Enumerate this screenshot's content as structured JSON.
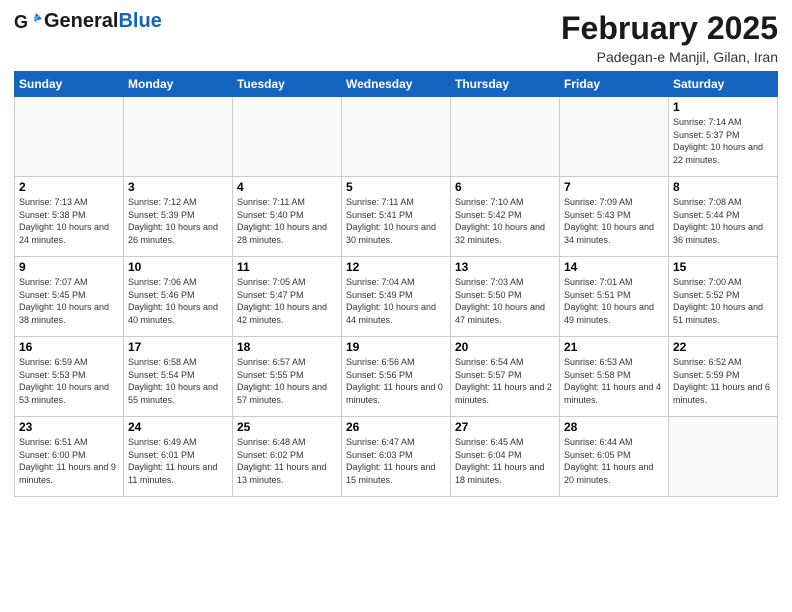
{
  "logo": {
    "general": "General",
    "blue": "Blue"
  },
  "title": "February 2025",
  "subtitle": "Padegan-e Manjil, Gilan, Iran",
  "headers": [
    "Sunday",
    "Monday",
    "Tuesday",
    "Wednesday",
    "Thursday",
    "Friday",
    "Saturday"
  ],
  "weeks": [
    [
      {
        "day": "",
        "info": ""
      },
      {
        "day": "",
        "info": ""
      },
      {
        "day": "",
        "info": ""
      },
      {
        "day": "",
        "info": ""
      },
      {
        "day": "",
        "info": ""
      },
      {
        "day": "",
        "info": ""
      },
      {
        "day": "1",
        "info": "Sunrise: 7:14 AM\nSunset: 5:37 PM\nDaylight: 10 hours\nand 22 minutes."
      }
    ],
    [
      {
        "day": "2",
        "info": "Sunrise: 7:13 AM\nSunset: 5:38 PM\nDaylight: 10 hours\nand 24 minutes."
      },
      {
        "day": "3",
        "info": "Sunrise: 7:12 AM\nSunset: 5:39 PM\nDaylight: 10 hours\nand 26 minutes."
      },
      {
        "day": "4",
        "info": "Sunrise: 7:11 AM\nSunset: 5:40 PM\nDaylight: 10 hours\nand 28 minutes."
      },
      {
        "day": "5",
        "info": "Sunrise: 7:11 AM\nSunset: 5:41 PM\nDaylight: 10 hours\nand 30 minutes."
      },
      {
        "day": "6",
        "info": "Sunrise: 7:10 AM\nSunset: 5:42 PM\nDaylight: 10 hours\nand 32 minutes."
      },
      {
        "day": "7",
        "info": "Sunrise: 7:09 AM\nSunset: 5:43 PM\nDaylight: 10 hours\nand 34 minutes."
      },
      {
        "day": "8",
        "info": "Sunrise: 7:08 AM\nSunset: 5:44 PM\nDaylight: 10 hours\nand 36 minutes."
      }
    ],
    [
      {
        "day": "9",
        "info": "Sunrise: 7:07 AM\nSunset: 5:45 PM\nDaylight: 10 hours\nand 38 minutes."
      },
      {
        "day": "10",
        "info": "Sunrise: 7:06 AM\nSunset: 5:46 PM\nDaylight: 10 hours\nand 40 minutes."
      },
      {
        "day": "11",
        "info": "Sunrise: 7:05 AM\nSunset: 5:47 PM\nDaylight: 10 hours\nand 42 minutes."
      },
      {
        "day": "12",
        "info": "Sunrise: 7:04 AM\nSunset: 5:49 PM\nDaylight: 10 hours\nand 44 minutes."
      },
      {
        "day": "13",
        "info": "Sunrise: 7:03 AM\nSunset: 5:50 PM\nDaylight: 10 hours\nand 47 minutes."
      },
      {
        "day": "14",
        "info": "Sunrise: 7:01 AM\nSunset: 5:51 PM\nDaylight: 10 hours\nand 49 minutes."
      },
      {
        "day": "15",
        "info": "Sunrise: 7:00 AM\nSunset: 5:52 PM\nDaylight: 10 hours\nand 51 minutes."
      }
    ],
    [
      {
        "day": "16",
        "info": "Sunrise: 6:59 AM\nSunset: 5:53 PM\nDaylight: 10 hours\nand 53 minutes."
      },
      {
        "day": "17",
        "info": "Sunrise: 6:58 AM\nSunset: 5:54 PM\nDaylight: 10 hours\nand 55 minutes."
      },
      {
        "day": "18",
        "info": "Sunrise: 6:57 AM\nSunset: 5:55 PM\nDaylight: 10 hours\nand 57 minutes."
      },
      {
        "day": "19",
        "info": "Sunrise: 6:56 AM\nSunset: 5:56 PM\nDaylight: 11 hours\nand 0 minutes."
      },
      {
        "day": "20",
        "info": "Sunrise: 6:54 AM\nSunset: 5:57 PM\nDaylight: 11 hours\nand 2 minutes."
      },
      {
        "day": "21",
        "info": "Sunrise: 6:53 AM\nSunset: 5:58 PM\nDaylight: 11 hours\nand 4 minutes."
      },
      {
        "day": "22",
        "info": "Sunrise: 6:52 AM\nSunset: 5:59 PM\nDaylight: 11 hours\nand 6 minutes."
      }
    ],
    [
      {
        "day": "23",
        "info": "Sunrise: 6:51 AM\nSunset: 6:00 PM\nDaylight: 11 hours\nand 9 minutes."
      },
      {
        "day": "24",
        "info": "Sunrise: 6:49 AM\nSunset: 6:01 PM\nDaylight: 11 hours\nand 11 minutes."
      },
      {
        "day": "25",
        "info": "Sunrise: 6:48 AM\nSunset: 6:02 PM\nDaylight: 11 hours\nand 13 minutes."
      },
      {
        "day": "26",
        "info": "Sunrise: 6:47 AM\nSunset: 6:03 PM\nDaylight: 11 hours\nand 15 minutes."
      },
      {
        "day": "27",
        "info": "Sunrise: 6:45 AM\nSunset: 6:04 PM\nDaylight: 11 hours\nand 18 minutes."
      },
      {
        "day": "28",
        "info": "Sunrise: 6:44 AM\nSunset: 6:05 PM\nDaylight: 11 hours\nand 20 minutes."
      },
      {
        "day": "",
        "info": ""
      }
    ]
  ]
}
